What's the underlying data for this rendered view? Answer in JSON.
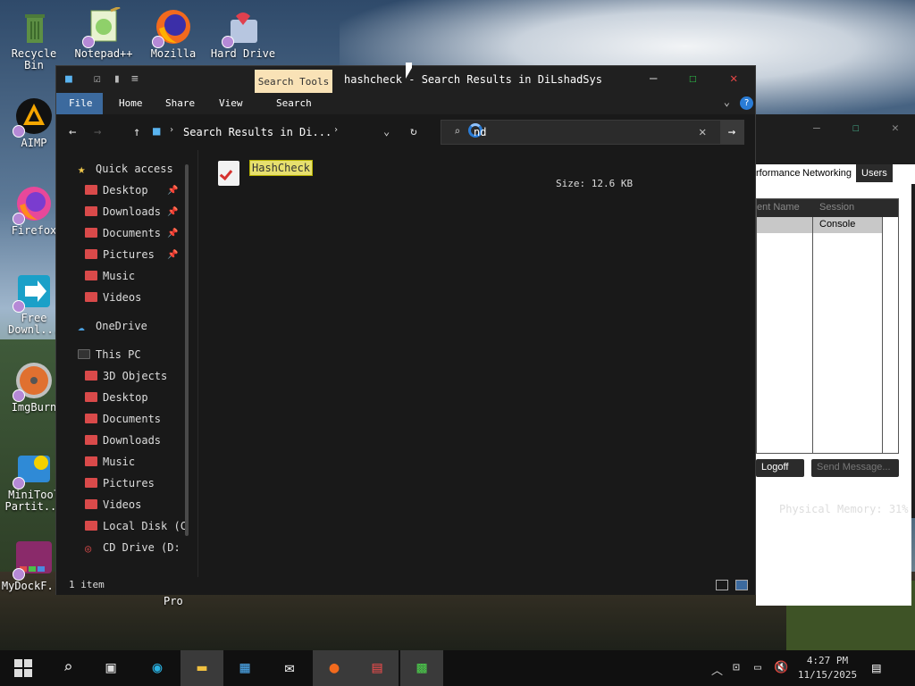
{
  "desktop": {
    "icons": [
      {
        "label": "Recycle Bin",
        "icon": "recycle-bin-icon"
      },
      {
        "label": "Notepad++",
        "icon": "notepad-plus-plus-icon"
      },
      {
        "label": "Mozilla",
        "icon": "firefox-icon"
      },
      {
        "label": "Hard Drive",
        "icon": "hard-drive-icon"
      },
      {
        "label": "AIMP",
        "icon": "aimp-icon"
      },
      {
        "label": "Firefox",
        "icon": "firefox-icon"
      },
      {
        "label": "Free Downl...",
        "icon": "free-download-manager-icon"
      },
      {
        "label": "ImgBurn",
        "icon": "imgburn-icon"
      },
      {
        "label": "MiniTool Partit...",
        "icon": "minitool-partition-icon"
      },
      {
        "label": "MyDockF...",
        "icon": "mydock-icon"
      }
    ],
    "pro_label": "Pro"
  },
  "task_manager": {
    "tabs": [
      "rformance",
      "Networking",
      "Users"
    ],
    "active_tab": "Users",
    "columns": [
      "ent Name",
      "Session"
    ],
    "row_session": "Console",
    "logoff_label": "Logoff",
    "send_message_label": "Send Message...",
    "status": "Physical Memory: 31%"
  },
  "explorer": {
    "search_tools_tab": "Search Tools",
    "title": "hashcheck - Search Results in DiLshadSys",
    "ribbon_tabs": {
      "file": "File",
      "home": "Home",
      "share": "Share",
      "view": "View",
      "search": "Search"
    },
    "address": "Search Results in Di...",
    "search_query": "nd",
    "nav": {
      "quick_access": "Quick access",
      "quick_items": [
        {
          "label": "Desktop",
          "pinned": true
        },
        {
          "label": "Downloads",
          "pinned": true
        },
        {
          "label": "Documents",
          "pinned": true
        },
        {
          "label": "Pictures",
          "pinned": true
        },
        {
          "label": "Music",
          "pinned": false
        },
        {
          "label": "Videos",
          "pinned": false
        }
      ],
      "onedrive": "OneDrive",
      "this_pc": "This PC",
      "pc_items": [
        "3D Objects",
        "Desktop",
        "Documents",
        "Downloads",
        "Music",
        "Pictures",
        "Videos",
        "Local Disk (C",
        "CD Drive (D:"
      ]
    },
    "results": [
      {
        "name": "HashCheck",
        "size_label": "Size:",
        "size": "12.6 KB"
      }
    ],
    "status_count": "1 item"
  },
  "taskbar": {
    "time": "4:27 PM",
    "date": "11/15/2025"
  },
  "colors": {
    "accent": "#3c6a9e",
    "search_tools_tab": "#f9e2b6",
    "highlight": "#e7e06e",
    "folder_red": "#d94a4a"
  }
}
